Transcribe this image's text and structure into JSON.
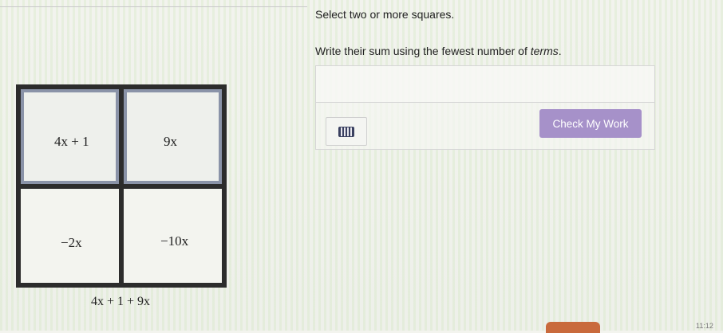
{
  "instructions": "Select two or more squares.",
  "prompt": {
    "before": "Write their sum using the fewest number of ",
    "emph": "terms",
    "after": "."
  },
  "answer": {
    "value": "",
    "keyboard_icon": "keyboard-icon"
  },
  "check_button": "Check My Work",
  "squares": [
    {
      "expr": "4x + 1",
      "selected": true
    },
    {
      "expr": "9x",
      "selected": true
    },
    {
      "expr": "−2x",
      "selected": false
    },
    {
      "expr": "−10x",
      "selected": false
    }
  ],
  "selected_sum": "4x + 1 + 9x",
  "clock": "11:12"
}
